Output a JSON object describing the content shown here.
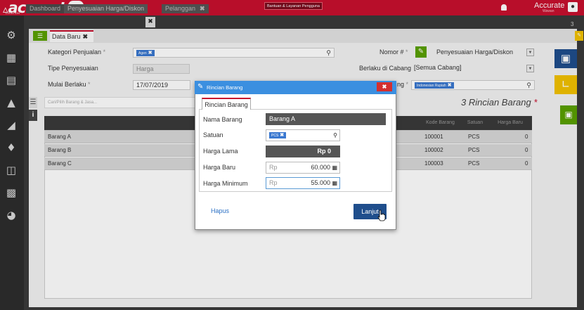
{
  "app": {
    "logo": "accurate",
    "logo_sub": "online",
    "location_tag": "LOCATION",
    "help_label": "Bantuan & Layanan Pengguna",
    "user_name": "Accurate",
    "user_role": "Wawan",
    "tab_count": "3"
  },
  "colors": {
    "brand": "#c8102e",
    "primary": "#1f4e8c",
    "accent_green": "#5aa000",
    "accent_yellow": "#f2c200",
    "dialog_title": "#3b8fe0"
  },
  "tabs": [
    {
      "label": "Dashboard"
    },
    {
      "label": "Penyesuaian Harga/Diskon",
      "close": "✖"
    },
    {
      "label": "Pelanggan",
      "close": "✖"
    }
  ],
  "subtab": {
    "label": "Data Baru",
    "close": "✖"
  },
  "form": {
    "kategori_label": "Kategori Penjualan",
    "kategori_chip": "Agen",
    "tipe_label": "Tipe Penyesuaian",
    "tipe_value": "Harga",
    "mulai_label": "Mulai Berlaku",
    "mulai_value": "17/07/2019",
    "nomor_label": "Nomor #",
    "nomor_value": "Penyesuaian Harga/Diskon",
    "cabang_label": "Berlaku di Cabang",
    "cabang_value": "[Semua Cabang]",
    "mata_uang_label_tail": "ng",
    "mata_uang_chip": "Indonesian Rupiah",
    "req": "*"
  },
  "table": {
    "search_placeholder": "Cari/Pilih Barang & Jasa...",
    "title": "3 Rincian Barang",
    "headers": [
      "Kode Barang",
      "Satuan",
      "Harga Baru"
    ],
    "rows": [
      {
        "name": "Barang A",
        "kode": "100001",
        "satuan": "PCS",
        "harga": "0"
      },
      {
        "name": "Barang B",
        "kode": "100002",
        "satuan": "PCS",
        "harga": "0"
      },
      {
        "name": "Barang C",
        "kode": "100003",
        "satuan": "PCS",
        "harga": "0"
      }
    ]
  },
  "dialog": {
    "title": "Rincian Barang",
    "close": "✖",
    "tab": "Rincian Barang",
    "nama_label": "Nama Barang",
    "nama_value": "Barang A",
    "satuan_label": "Satuan",
    "satuan_chip": "PCS",
    "harga_lama_label": "Harga Lama",
    "harga_lama_value": "Rp 0",
    "harga_baru_label": "Harga Baru",
    "harga_baru_prefix": "Rp",
    "harga_baru_value": "60.000",
    "harga_min_label": "Harga Minimum",
    "harga_min_prefix": "Rp",
    "harga_min_value": "55.000",
    "hapus": "Hapus",
    "lanjut": "Lanjut"
  },
  "icons": [
    "settings-icon",
    "building-icon",
    "document-icon",
    "gauge-icon",
    "cart-icon",
    "bag-icon",
    "calculator-icon",
    "cashier-icon",
    "pie-chart-icon",
    "save-icon",
    "attachment-icon",
    "toolbox-icon",
    "list-icon",
    "info-icon",
    "search-icon",
    "calculator-small-icon",
    "pencil-icon",
    "bell-icon",
    "user-icon"
  ]
}
